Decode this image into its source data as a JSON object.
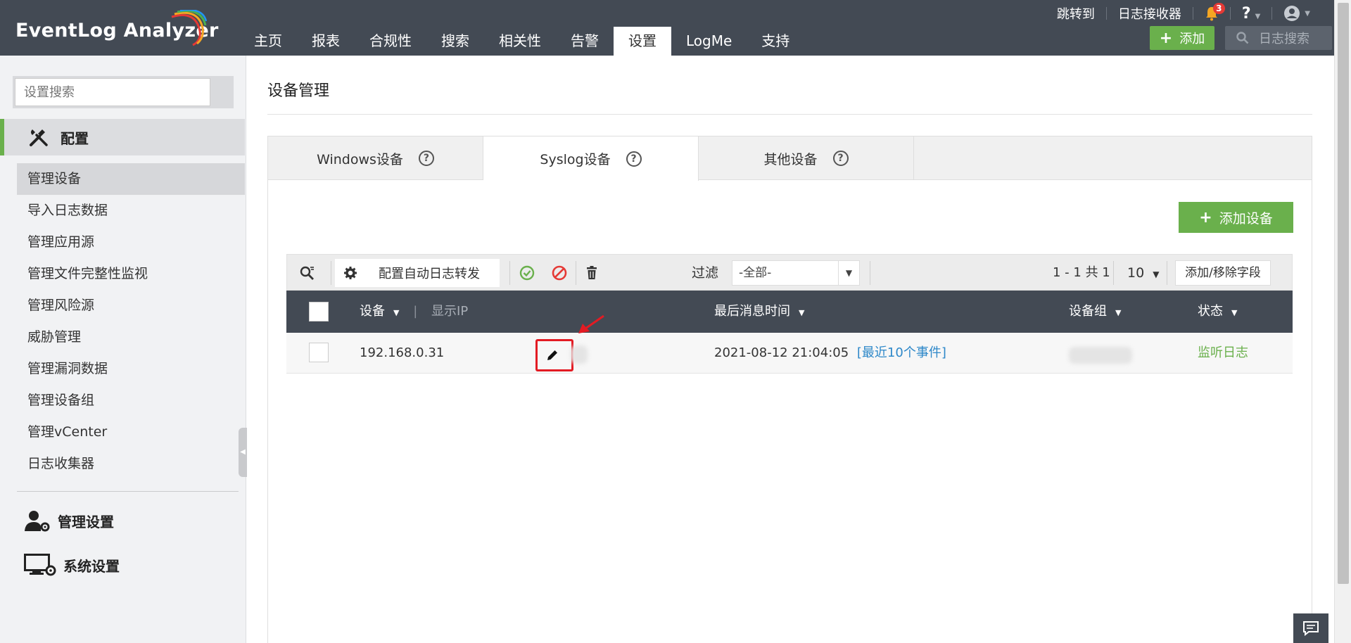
{
  "app": {
    "logo_text": "EventLog Analyzer",
    "nav": [
      "主页",
      "报表",
      "合规性",
      "搜索",
      "相关性",
      "告警",
      "设置",
      "LogMe",
      "支持"
    ],
    "active_nav": "设置",
    "util": {
      "jump_to": "跳转到",
      "log_receiver": "日志接收器",
      "notification_count": "3",
      "help": "?"
    },
    "add_label": "添加",
    "log_search_placeholder": "日志搜索"
  },
  "sidebar": {
    "search_placeholder": "设置搜索",
    "config_section": "配置",
    "items": [
      {
        "label": "管理设备",
        "active": true
      },
      {
        "label": "导入日志数据"
      },
      {
        "label": "管理应用源"
      },
      {
        "label": "管理文件完整性监视"
      },
      {
        "label": "管理风险源"
      },
      {
        "label": "威胁管理"
      },
      {
        "label": "管理漏洞数据"
      },
      {
        "label": "管理设备组"
      },
      {
        "label": "管理vCenter"
      },
      {
        "label": "日志收集器"
      }
    ],
    "admin_section": "管理设置",
    "system_section": "系统设置"
  },
  "main": {
    "title": "设备管理",
    "tabs": [
      {
        "label": "Windows设备"
      },
      {
        "label": "Syslog设备",
        "active": true
      },
      {
        "label": "其他设备"
      }
    ],
    "add_device_label": "添加设备",
    "toolbar": {
      "auto_forward_label": "配置自动日志转发",
      "filter_label": "过滤",
      "filter_value": "-全部-",
      "page_info": "1 - 1 共 1",
      "page_size": "10",
      "columns_label": "添加/移除字段"
    },
    "table": {
      "headers": {
        "device": "设备",
        "show_ip": "显示IP",
        "last_msg_time": "最后消息时间",
        "device_group": "设备组",
        "status": "状态"
      },
      "rows": [
        {
          "device": "192.168.0.31",
          "last_msg_time": "2021-08-12 21:04:05",
          "recent_events": "[最近10个事件]",
          "status": "监听日志"
        }
      ]
    }
  },
  "colors": {
    "header_bg": "#434a54",
    "accent_green": "#6ab04c",
    "link_blue": "#2e88c9",
    "highlight_red": "#e31b23"
  }
}
